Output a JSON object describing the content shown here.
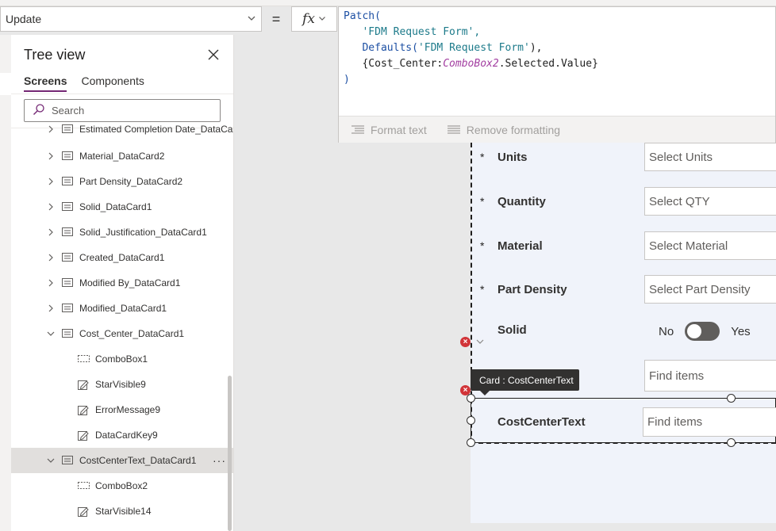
{
  "formula_bar": {
    "property": "Update",
    "equals": "=",
    "fx": "fx",
    "code_lines": {
      "l1": "Patch(",
      "l2": "'FDM Request Form',",
      "l3_fn": "Defaults(",
      "l3_str": "'FDM Request Form'",
      "l3_end": "),",
      "l4_a": "{Cost_Center:",
      "l4_ctl": "ComboBox2",
      "l4_b": ".Selected.Value}",
      "l5": ")"
    },
    "tools": {
      "format_text": "Format text",
      "remove_formatting": "Remove formatting"
    }
  },
  "tree_view": {
    "title": "Tree view",
    "tabs": {
      "screens": "Screens",
      "components": "Components"
    },
    "search_placeholder": "Search",
    "items": [
      {
        "label": "Estimated Completion Date_DataCard",
        "kind": "card",
        "level": 1,
        "expand": "right"
      },
      {
        "label": "Material_DataCard2",
        "kind": "card",
        "level": 1,
        "expand": "right"
      },
      {
        "label": "Part Density_DataCard2",
        "kind": "card",
        "level": 1,
        "expand": "right"
      },
      {
        "label": "Solid_DataCard1",
        "kind": "card",
        "level": 1,
        "expand": "right"
      },
      {
        "label": "Solid_Justification_DataCard1",
        "kind": "card",
        "level": 1,
        "expand": "right"
      },
      {
        "label": "Created_DataCard1",
        "kind": "card",
        "level": 1,
        "expand": "right"
      },
      {
        "label": "Modified By_DataCard1",
        "kind": "card",
        "level": 1,
        "expand": "right"
      },
      {
        "label": "Modified_DataCard1",
        "kind": "card",
        "level": 1,
        "expand": "right"
      },
      {
        "label": "Cost_Center_DataCard1",
        "kind": "card",
        "level": 1,
        "expand": "down"
      },
      {
        "label": "ComboBox1",
        "kind": "combo",
        "level": 2
      },
      {
        "label": "StarVisible9",
        "kind": "label",
        "level": 2
      },
      {
        "label": "ErrorMessage9",
        "kind": "label",
        "level": 2
      },
      {
        "label": "DataCardKey9",
        "kind": "label",
        "level": 2
      },
      {
        "label": "CostCenterText_DataCard1",
        "kind": "card",
        "level": 1,
        "expand": "down",
        "selected": true,
        "more": "···"
      },
      {
        "label": "ComboBox2",
        "kind": "combo",
        "level": 2
      },
      {
        "label": "StarVisible14",
        "kind": "label",
        "level": 2
      }
    ]
  },
  "form": {
    "fields": [
      {
        "label": "Units",
        "placeholder": "Select Units",
        "required": "*"
      },
      {
        "label": "Quantity",
        "placeholder": "Select QTY",
        "required": "*"
      },
      {
        "label": "Material",
        "placeholder": "Select Material",
        "required": "*"
      },
      {
        "label": "Part Density",
        "placeholder": "Select Part Density",
        "required": "*"
      }
    ],
    "solid": {
      "label": "Solid",
      "no": "No",
      "yes": "Yes",
      "on": false
    },
    "find_items_1": "Find items",
    "tooltip": "Card : CostCenterText",
    "cost_center_text": {
      "label": "CostCenterText",
      "placeholder": "Find items"
    },
    "error_mark": "×"
  }
}
